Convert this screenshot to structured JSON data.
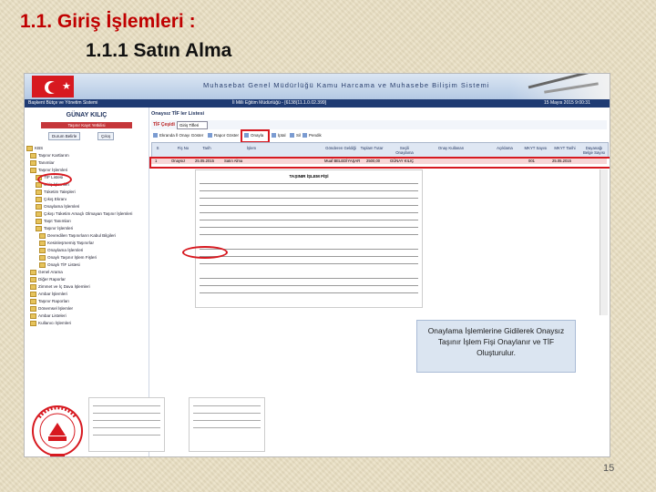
{
  "slide": {
    "title": "1.1. Giriş İşlemleri :",
    "subtitle": "1.1.1  Satın Alma",
    "callout": "Onaylama İşlemlerine Gidilerek Onaysız Taşınır İşlem Fişi Onaylanır ve TİF Oluşturulur.",
    "page_number": "15"
  },
  "app": {
    "banner_title": "Muhasebat Genel Müdürlüğü Kamu Harcama ve Muhasebe Bilişim Sistemi",
    "navbar_left": "Başkent Bütçe ve Yönetim Sistemi",
    "navbar_center": "İl Milli Eğitim Müdürlüğü - [6138(11.1.0.02.399]",
    "navbar_right": "15 Mayıs 2015 9:00:31"
  },
  "sidebar": {
    "user_name": "GÜNAY KILIÇ",
    "user_role": "Taşınır Kayıt Yetkilisi",
    "buttons": [
      "Durum Belirle",
      "Çıkış"
    ],
    "tree": [
      "KBS",
      "Taşınır Kartlarım",
      "Tanımlar",
      "Taşınır İşlemleri",
      "TİF Listesi",
      "Giriş İşlemleri",
      "Tüketim Talepleri",
      "Çıkış Ekranı",
      "Onaylama İşlemleri",
      "Çıkışı Tüketim Amaçlı Olmayan Taşınır İşlemleri",
      "Taşıt Tanımları",
      "Taşınır İşlemleri",
      "Devredilen Taşınırların Kabul Bilgileri",
      "Kesinleşmemiş Taşınırlar",
      "Onaylama İşlemleri",
      "Onaylı Taşınır İşlem Fişleri",
      "Onaylı TİF Listesi",
      "Genel Arama",
      "Diğer Raporlar",
      "Zimmet ve İç Dava İşlemleri",
      "Ambar İşlemleri",
      "Taşınır Raporları",
      "Dönemsel İşlemler",
      "Ambar Listeleri",
      "Kullanıcı İşlemleri"
    ]
  },
  "main": {
    "panel_title": "Onaysız TİF ler Listesi",
    "tif_label": "TİF Çeşidi",
    "tif_select": "Giriş Tifleri",
    "toolbar": [
      "Ekranda İl Onayı Göster",
      "Rapor Göster",
      "Onayla",
      "İptal",
      "Sil",
      "Pendik"
    ],
    "columns": [
      "S",
      "Fiş No",
      "Tarih",
      "İşlem",
      "Gönderen Geldiği",
      "Toplam Tutar",
      "Seçili Onaylama",
      "Onay Kullanan",
      "Açıklama",
      "MKYT Sayısı",
      "MKYT Tarihi",
      "Dayanağı Belge Sayısı"
    ],
    "row": [
      "1",
      "Onaysız",
      "25.05.2015",
      "Satın Alma",
      "",
      "",
      "Muaf BELEDİYAŞAR",
      "2500,00",
      "GÜNAY KILIÇ",
      "",
      "001",
      "25.05.2015"
    ],
    "doc_title": "TAŞINIR İŞLEM FİŞİ"
  }
}
